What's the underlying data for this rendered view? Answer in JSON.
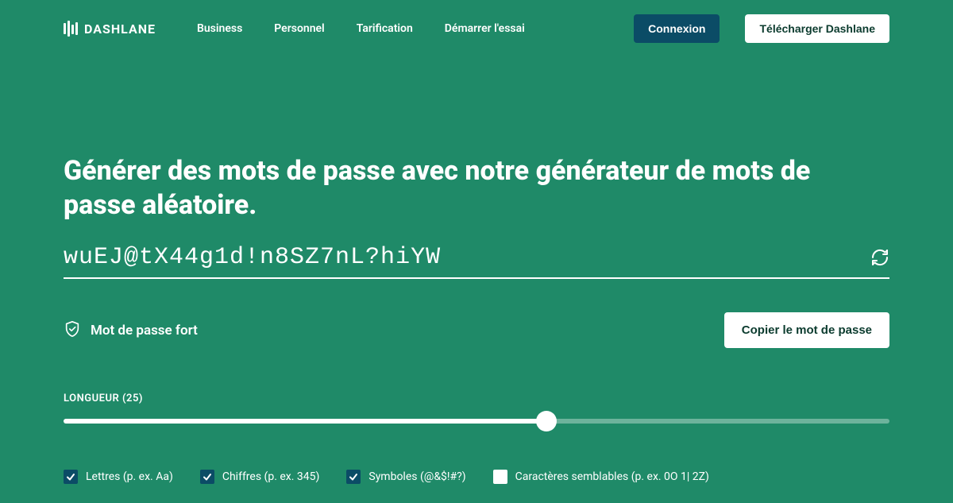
{
  "brand": "DASHLANE",
  "nav": {
    "business": "Business",
    "personal": "Personnel",
    "pricing": "Tarification",
    "trial": "Démarrer l'essai"
  },
  "actions": {
    "login": "Connexion",
    "download": "Télécharger Dashlane"
  },
  "heading": "Générer des mots de passe avec notre générateur de mots de passe aléatoire.",
  "password": "wuEJ@tX44g1d!n8SZ7nL?hiYW",
  "strength": "Mot de passe fort",
  "copy": "Copier le mot de passe",
  "length": {
    "label": "LONGUEUR (25)",
    "value": 25,
    "min": 4,
    "max": 40
  },
  "options": {
    "letters": {
      "label": "Lettres (p. ex. Aa)",
      "checked": true
    },
    "digits": {
      "label": "Chiffres (p. ex. 345)",
      "checked": true
    },
    "symbols": {
      "label": "Symboles (@&$!#?)",
      "checked": true
    },
    "similar": {
      "label": "Caractères semblables (p. ex. 0O 1| 2Z)",
      "checked": false
    }
  }
}
